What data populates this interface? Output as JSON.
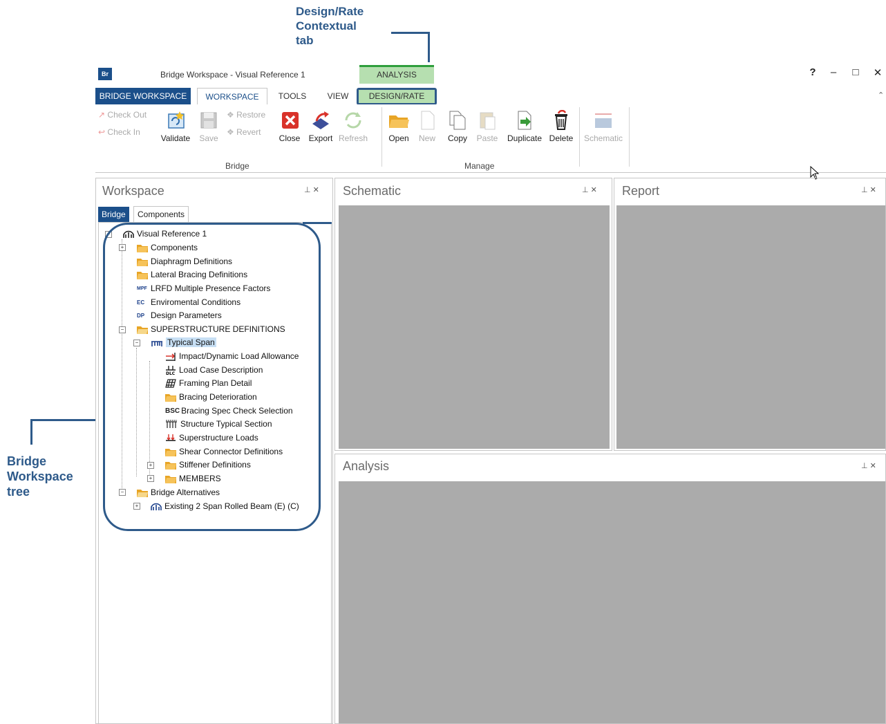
{
  "annotations": {
    "design_rate_callout": [
      "Design/Rate",
      "Contextual",
      "tab"
    ],
    "tree_callout": [
      "Bridge",
      "Workspace",
      "tree"
    ]
  },
  "window": {
    "title": "Bridge Workspace - Visual Reference 1",
    "logo": "Br",
    "contextual_group": "ANALYSIS",
    "controls": [
      "?",
      "–",
      "□",
      "✕"
    ]
  },
  "tabs": [
    "BRIDGE WORKSPACE",
    "WORKSPACE",
    "TOOLS",
    "VIEW",
    "DESIGN/RATE"
  ],
  "ribbon": {
    "bridge_group": {
      "label": "Bridge",
      "check_out": "Check Out",
      "check_in": "Check In",
      "validate": "Validate",
      "save": "Save",
      "restore": "Restore",
      "revert": "Revert",
      "close": "Close",
      "export": "Export",
      "refresh": "Refresh"
    },
    "manage_group": {
      "label": "Manage",
      "open": "Open",
      "new": "New",
      "copy": "Copy",
      "paste": "Paste",
      "duplicate": "Duplicate",
      "delete": "Delete"
    },
    "schematic_button": "Schematic"
  },
  "panels": {
    "workspace": "Workspace",
    "schematic": "Schematic",
    "report": "Report",
    "analysis": "Analysis",
    "pin_close": "⊥ ✕"
  },
  "workspace_tabs": [
    "Bridge",
    "Components"
  ],
  "tree": {
    "root": "Visual Reference 1",
    "items": [
      "Components",
      "Diaphragm Definitions",
      "Lateral Bracing Definitions",
      "LRFD Multiple Presence Factors",
      "Enviromental Conditions",
      "Design Parameters",
      "SUPERSTRUCTURE DEFINITIONS",
      "Typical Span",
      "Impact/Dynamic Load Allowance",
      "Load Case Description",
      "Framing Plan Detail",
      "Bracing Deterioration",
      "Bracing Spec Check Selection",
      "Structure Typical Section",
      "Superstructure Loads",
      "Shear Connector Definitions",
      "Stiffener Definitions",
      "MEMBERS",
      "Bridge Alternatives",
      "Existing 2 Span Rolled Beam  (E)  (C)"
    ],
    "icon_labels": {
      "mpf": "MPF",
      "ec": "EC",
      "dp": "DP",
      "bsc": "BSC"
    }
  },
  "colors": {
    "brand": "#1b4f8a",
    "annotation": "#2e5a8a",
    "contextual_green": "#b6dfb0",
    "panel_gray": "#ababab",
    "folder": "#f0b53a"
  }
}
